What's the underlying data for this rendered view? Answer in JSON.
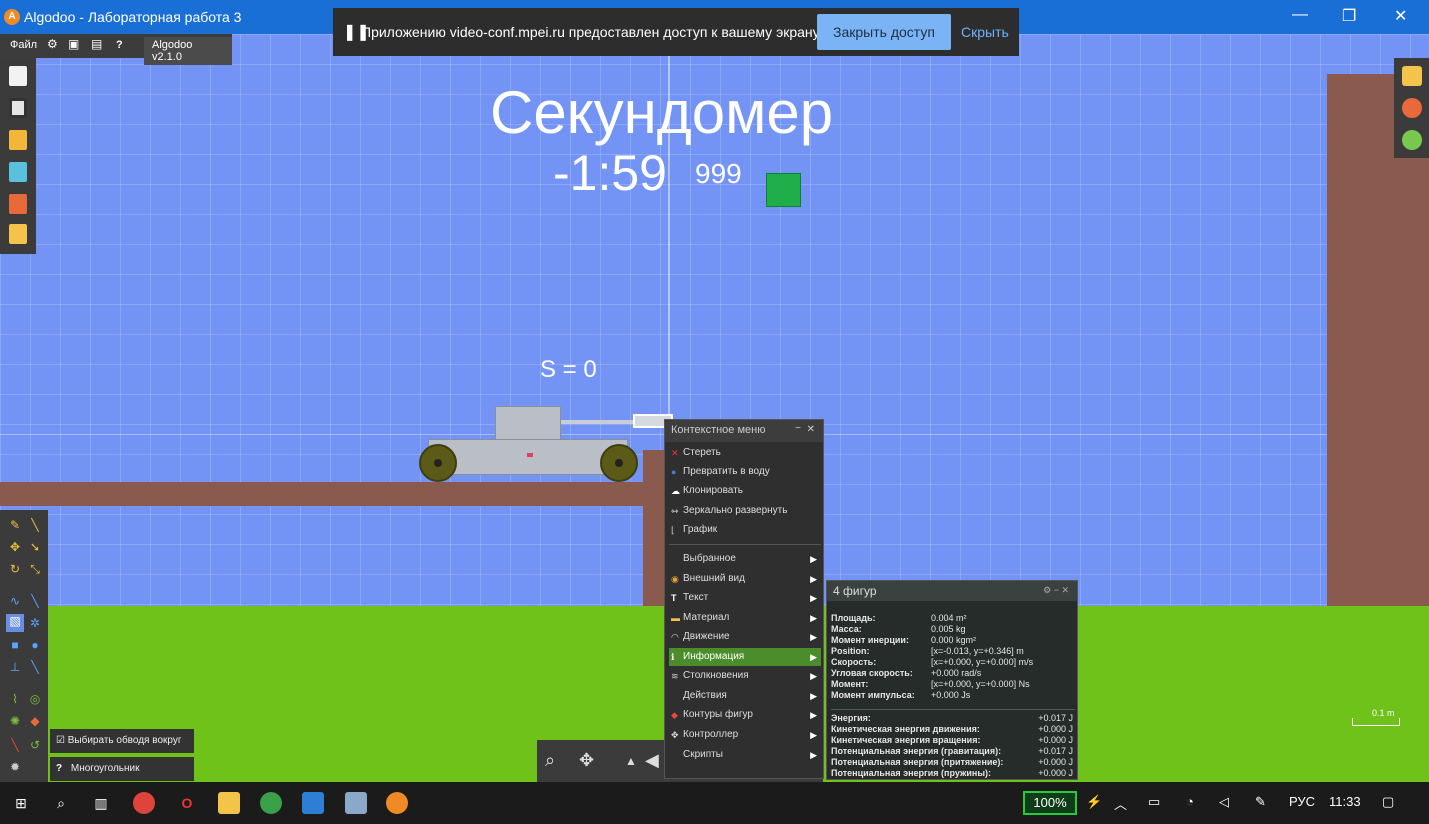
{
  "window": {
    "title": "Algodoo - Лабораторная работа 3",
    "app_icon": "algodoo-icon"
  },
  "notification": {
    "message": "Приложению video-conf.mpei.ru предоставлен доступ к вашему экрану.",
    "close_label": "Закрыть доступ",
    "hide_label": "Скрыть"
  },
  "menubar": {
    "file_label": "Файл",
    "version_label": "Algodoo v2.1.0",
    "help_label": "?"
  },
  "scene": {
    "heading": "Секундомер",
    "timer": "-1:59",
    "ms": "999",
    "distance": "S = 0",
    "scale_label": "0.1 m"
  },
  "bottom_options": {
    "select_around": "Выбирать обводя вокруг",
    "polygon": "Многоугольник"
  },
  "context_menu": {
    "title": "Контекстное меню",
    "items": [
      {
        "label": "Стереть",
        "icon": "x-icon"
      },
      {
        "label": "Превратить в воду",
        "icon": "water-drop-icon"
      },
      {
        "label": "Клонировать",
        "icon": "sheep-icon"
      },
      {
        "label": "Зеркально развернуть",
        "icon": "mirror-icon"
      },
      {
        "label": "График",
        "icon": "graph-icon"
      },
      {
        "label": "Выбранное",
        "icon": ""
      },
      {
        "label": "Внешний вид",
        "icon": "palette-icon"
      },
      {
        "label": "Текст",
        "icon": "text-icon"
      },
      {
        "label": "Материал",
        "icon": "material-icon"
      },
      {
        "label": "Движение",
        "icon": "velocity-icon"
      },
      {
        "label": "Информация",
        "icon": "info-icon"
      },
      {
        "label": "Столкновения",
        "icon": "collision-icon"
      },
      {
        "label": "Действия",
        "icon": ""
      },
      {
        "label": "Контуры фигур",
        "icon": "outline-icon"
      },
      {
        "label": "Контроллер",
        "icon": "controller-icon"
      },
      {
        "label": "Скрипты",
        "icon": ""
      }
    ]
  },
  "info_panel": {
    "title": "4 фигур",
    "rows": [
      {
        "k": "Площадь:",
        "v": "0.004 m²"
      },
      {
        "k": "Масса:",
        "v": "0.005 kg"
      },
      {
        "k": "Момент инерции:",
        "v": "0.000 kgm²"
      },
      {
        "k": "Position:",
        "v": "[x=-0.013, y=+0.346] m"
      },
      {
        "k": "Скорость:",
        "v": "[x=+0.000, y=+0.000] m/s"
      },
      {
        "k": "Угловая скорость:",
        "v": "+0.000 rad/s"
      },
      {
        "k": "Момент:",
        "v": "[x=+0.000, y=+0.000] Ns"
      },
      {
        "k": "Момент импульса:",
        "v": "+0.000 Js"
      }
    ],
    "energy_rows": [
      {
        "k": "Энергия:",
        "v": "+0.017 J"
      },
      {
        "k": "Кинетическая энергия движения:",
        "v": "+0.000 J"
      },
      {
        "k": "Кинетическая энергия вращения:",
        "v": "+0.000 J"
      },
      {
        "k": "Потенциальная энергия (гравитация):",
        "v": "+0.017 J"
      },
      {
        "k": "Потенциальная энергия (притяжение):",
        "v": "+0.000 J"
      },
      {
        "k": "Потенциальная энергия (пружины):",
        "v": "+0.000 J"
      }
    ]
  },
  "taskbar": {
    "battery": "100%",
    "lang": "РУС",
    "time": "11:33"
  },
  "colors": {
    "sky": "#7394f5",
    "ground": "#6ec21a",
    "wall": "#8a5a4f",
    "active_item": "#4c8d2b",
    "titlebar": "#1a6fd6"
  }
}
